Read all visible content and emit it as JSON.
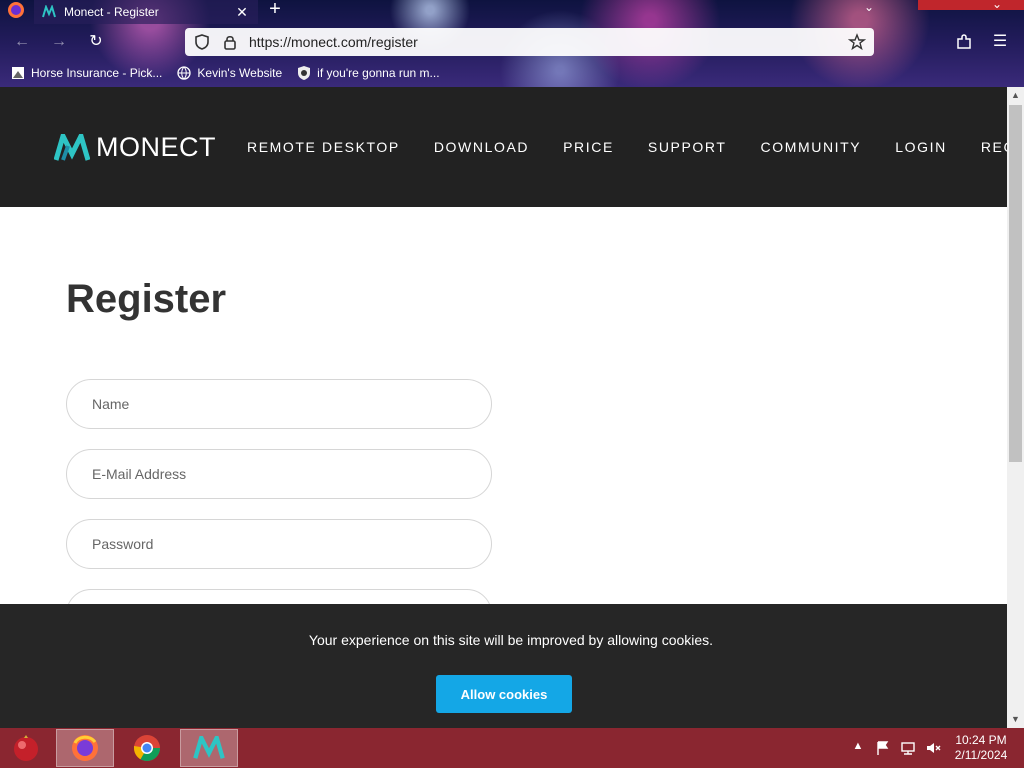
{
  "browser": {
    "tab_title": "Monect - Register",
    "url": "https://monect.com/register",
    "bookmarks": [
      {
        "label": "Horse Insurance - Pick..."
      },
      {
        "label": "Kevin's Website"
      },
      {
        "label": "if you're gonna run m..."
      }
    ]
  },
  "site": {
    "logo_text": "MONECT",
    "nav": [
      "REMOTE DESKTOP",
      "DOWNLOAD",
      "PRICE",
      "SUPPORT",
      "COMMUNITY",
      "LOGIN",
      "REGISTER"
    ],
    "accent_color": "#14a7e6"
  },
  "form": {
    "heading": "Register",
    "name_placeholder": "Name",
    "email_placeholder": "E-Mail Address",
    "password_placeholder": "Password",
    "name_value": "",
    "email_value": "",
    "password_value": ""
  },
  "cookie_banner": {
    "message": "Your experience on this site will be improved by allowing cookies.",
    "button_label": "Allow cookies"
  },
  "taskbar": {
    "time": "10:24 PM",
    "date": "2/11/2024"
  }
}
